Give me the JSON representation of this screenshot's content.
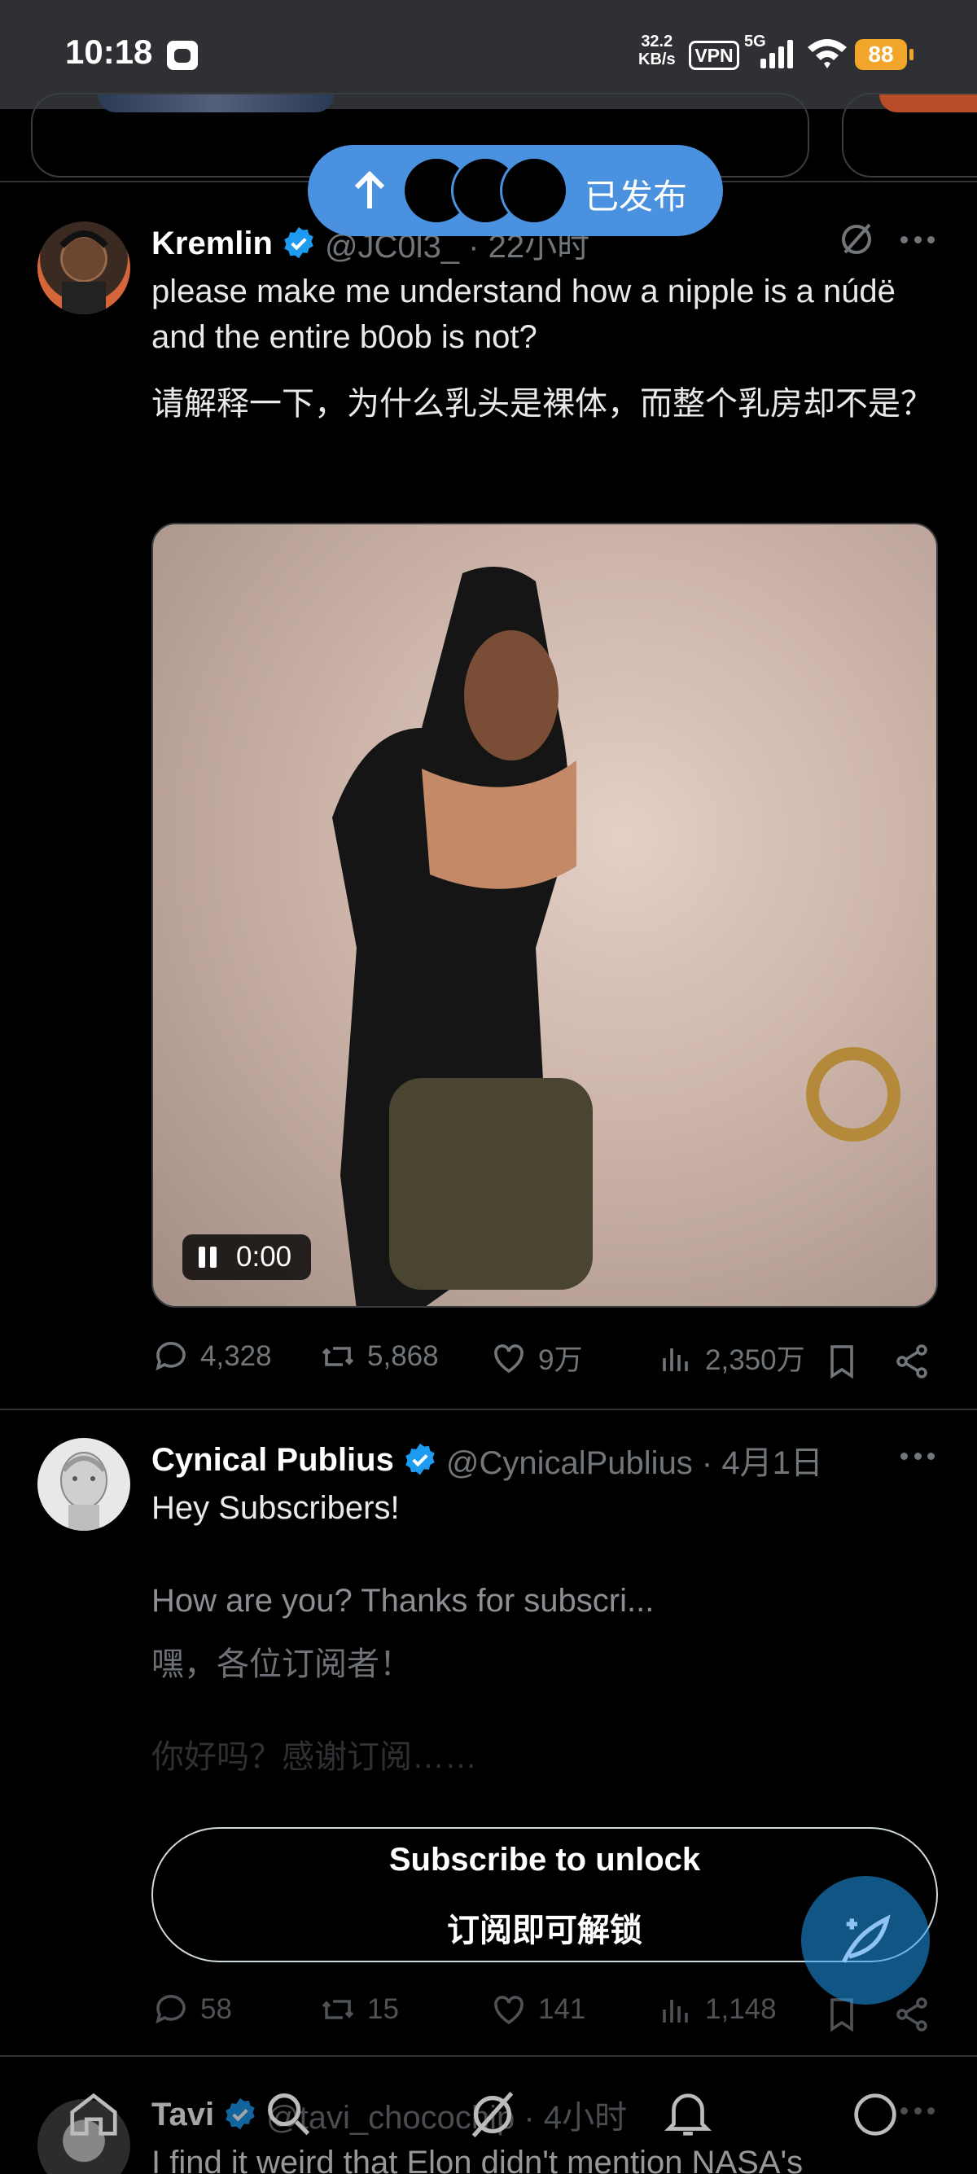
{
  "status_bar": {
    "time": "10:18",
    "net_speed_value": "32.2",
    "net_speed_unit": "KB/s",
    "vpn": "VPN",
    "network": "5G",
    "battery": "88"
  },
  "toast": {
    "label": "已发布",
    "arrow_icon": "arrow-up-icon"
  },
  "tweets": [
    {
      "name": "Kremlin",
      "handle": "@JC0l3_ · 22小时",
      "text": "please make me understand how a nipple is a núdë and the entire b0ob is not?",
      "translation": "请解释一下，为什么乳头是裸体，而整个乳房却不是？",
      "video_time": "0:00",
      "replies": "4,328",
      "reposts": "5,868",
      "likes": "9万",
      "views": "2,350万"
    },
    {
      "name": "Cynical Publius",
      "handle": "@CynicalPublius · 4月1日",
      "text_line1": "Hey Subscribers!",
      "text_line2": "How are you?  Thanks for subscri...",
      "translation_line1": "嘿，各位订阅者！",
      "translation_line2": "你好吗？感谢订阅……",
      "subscribe_label": "Subscribe to unlock",
      "subscribe_label_zh": "订阅即可解锁",
      "replies": "58",
      "reposts": "15",
      "likes": "141",
      "views": "1,148"
    },
    {
      "name": "Tavi",
      "handle": "@tavi_chocochip · 4小时",
      "text": "I find it weird that Elon didn't mention NASA's"
    }
  ],
  "colors": {
    "accent": "#1d9bf0",
    "toast": "#4a92e0",
    "muted": "#71767b",
    "battery": "#f2a52b"
  }
}
